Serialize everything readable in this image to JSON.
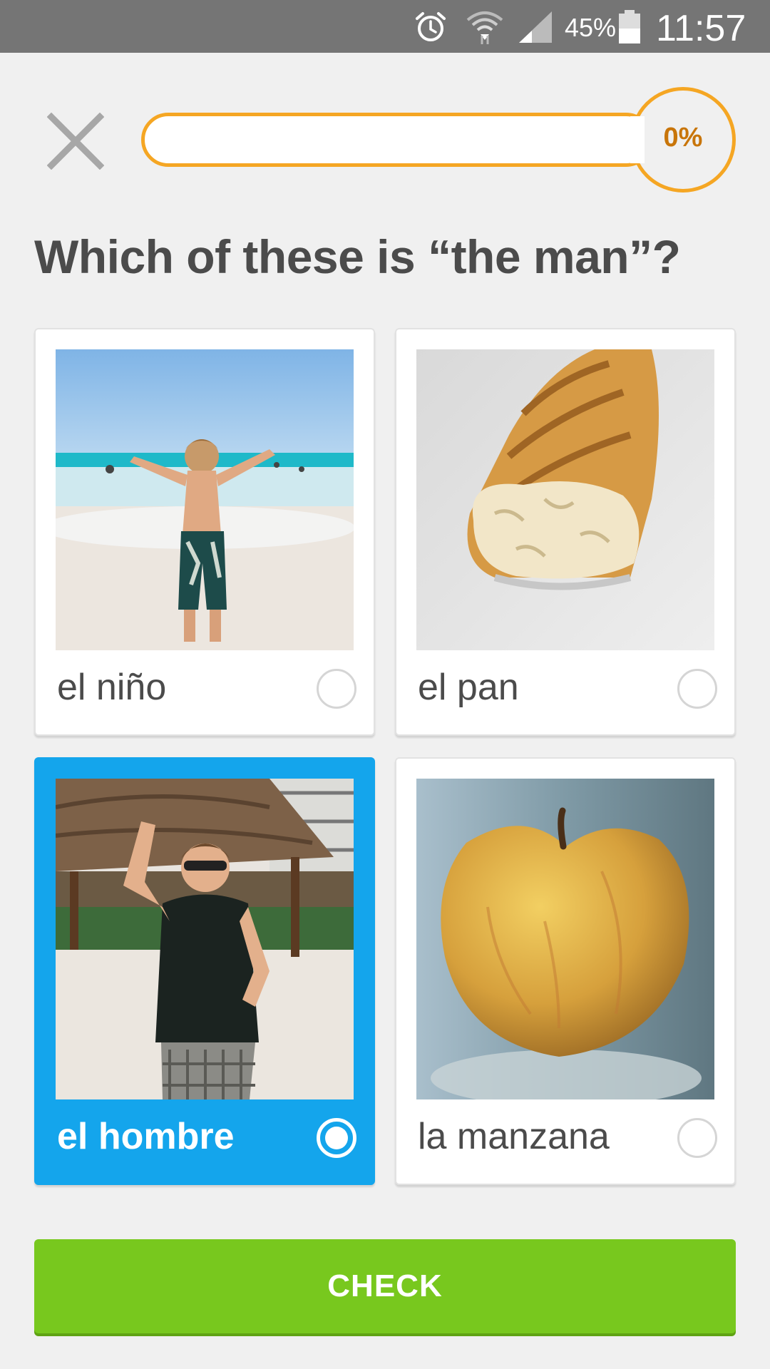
{
  "status_bar": {
    "battery_percent": "45%",
    "time": "11:57",
    "icons": [
      "alarm-icon",
      "wifi-icon",
      "signal-icon",
      "battery-icon"
    ]
  },
  "header": {
    "close_icon": "close-icon",
    "progress": {
      "value": 0,
      "label": "0%"
    }
  },
  "question": "Which of these is “the man”?",
  "choices": [
    {
      "label": "el niño",
      "image": "boy-on-beach",
      "selected": false
    },
    {
      "label": "el pan",
      "image": "baguette-bread",
      "selected": false
    },
    {
      "label": "el hombre",
      "image": "man-waving-on-beach",
      "selected": true
    },
    {
      "label": "la manzana",
      "image": "yellow-apple",
      "selected": false
    }
  ],
  "check_button": {
    "label": "CHECK"
  },
  "colors": {
    "accent_selected": "#14a5ec",
    "check_green": "#78c81e",
    "progress_orange": "#f5a623"
  }
}
